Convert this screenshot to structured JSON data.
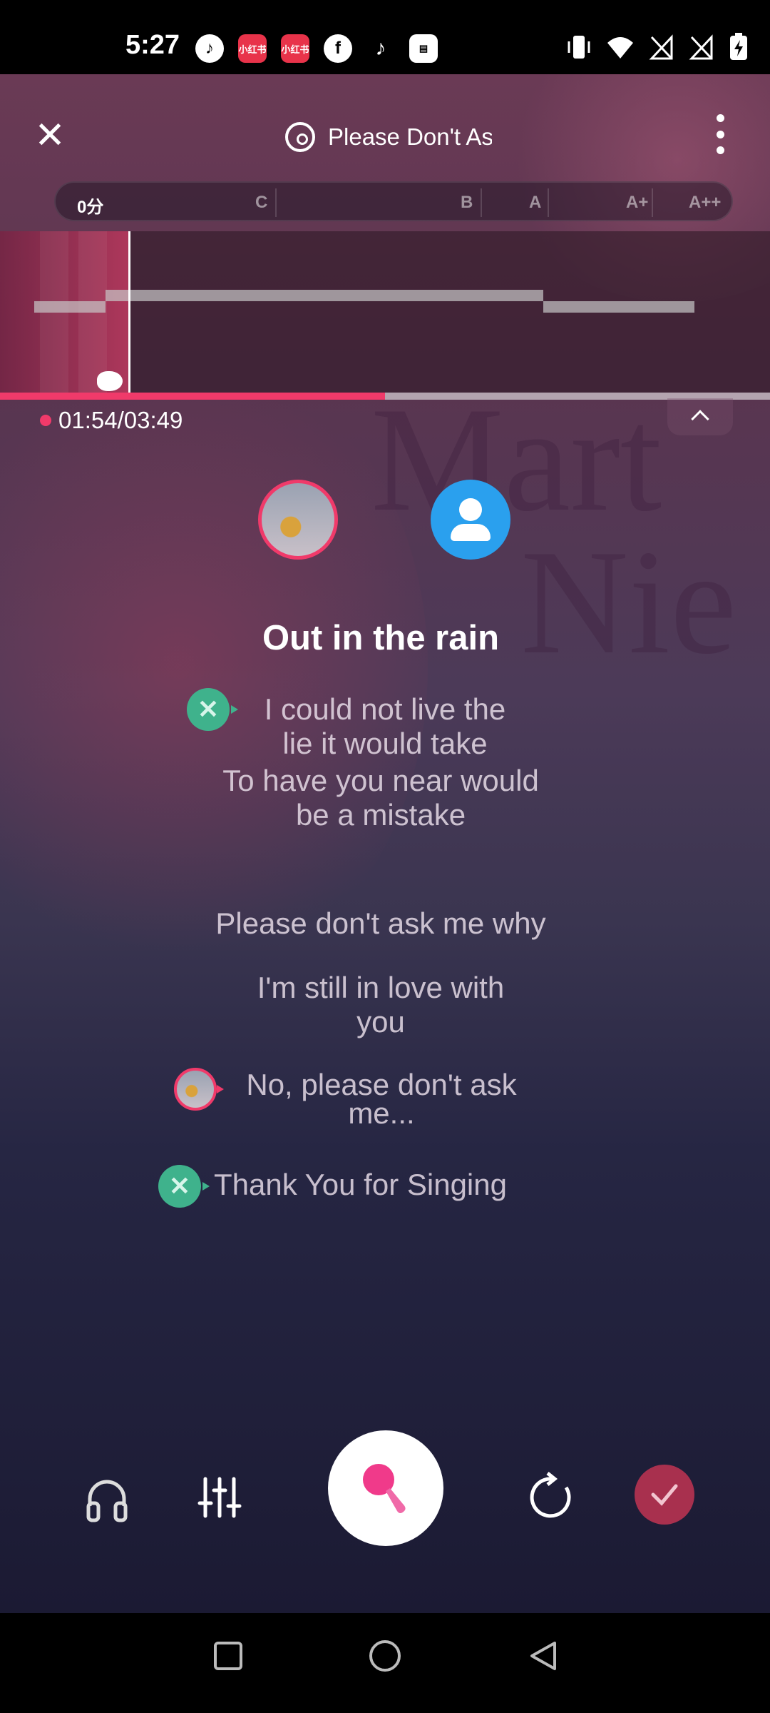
{
  "status_bar": {
    "time": "5:27",
    "app_icons": [
      "tiktok-alt-icon",
      "xiaohongshu-icon",
      "xiaohongshu-icon",
      "facebook-icon",
      "tiktok-icon",
      "wallet-icon"
    ],
    "xhs_label": "小红书",
    "right_icons": [
      "vibrate-icon",
      "wifi-icon",
      "no-signal-icon",
      "no-signal-icon",
      "battery-charging-icon"
    ]
  },
  "header": {
    "song_title": "Please Don't Ask Me"
  },
  "score_bar": {
    "current": "0分",
    "grades": [
      "C",
      "B",
      "A",
      "A+",
      "A++"
    ]
  },
  "playback": {
    "time": "01:54/03:49",
    "progress": 0.5
  },
  "lyrics": {
    "current": "Out in the rain",
    "lines": [
      {
        "text": "I could not live the\nlie it would take",
        "marker": "green"
      },
      {
        "text": "To have you near would\nbe a mistake",
        "marker": ""
      },
      {
        "text": "Please don't ask me why",
        "marker": ""
      },
      {
        "text": "I'm still in love with\nyou",
        "marker": ""
      },
      {
        "text": "No, please don't ask\nme...",
        "marker": "pink"
      },
      {
        "text": "Thank You for Singing",
        "marker": "green"
      }
    ]
  },
  "colors": {
    "accent": "#f03a6a",
    "singer_b": "#2aa0ee",
    "done": "#a8304e",
    "marker_green": "#3fb28c"
  }
}
